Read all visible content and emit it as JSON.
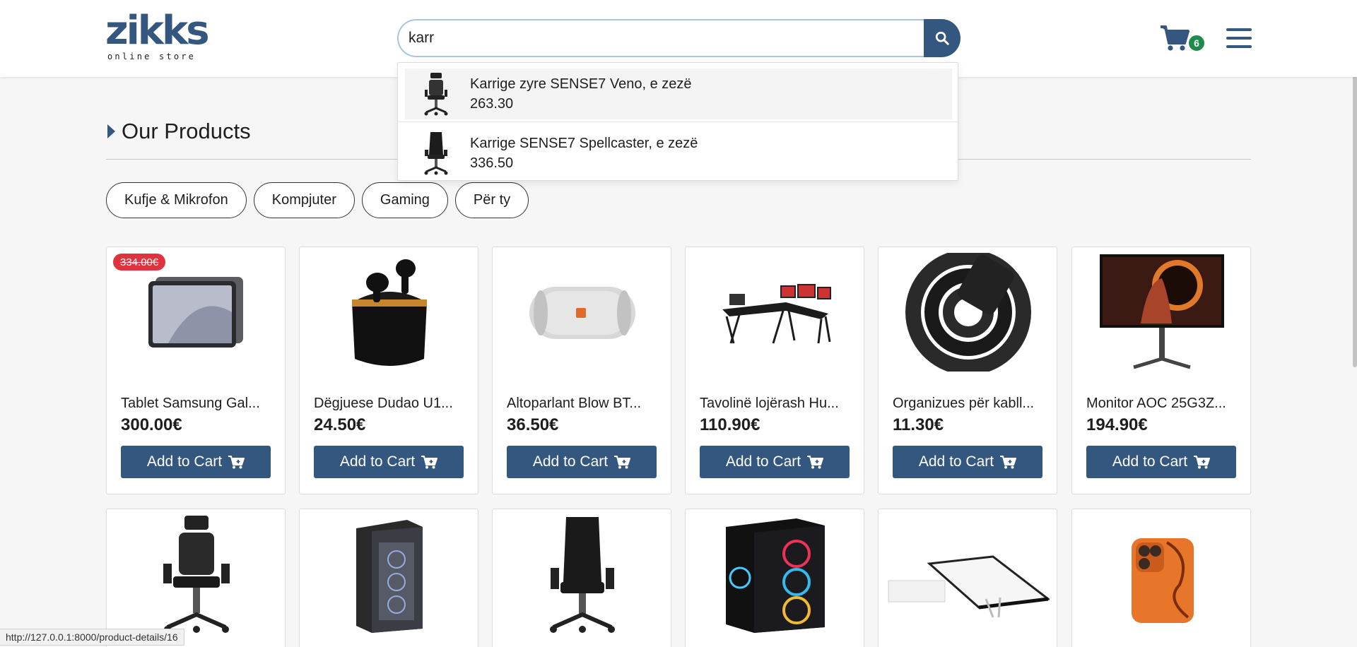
{
  "header": {
    "logo_text": "zikks",
    "logo_tagline": "online store",
    "search_value": "karr",
    "cart_count": "6"
  },
  "dropdown": {
    "items": [
      {
        "name": "Karrige zyre SENSE7 Veno, e zezë",
        "price": "263.30"
      },
      {
        "name": "Karrige SENSE7 Spellcaster, e zezë",
        "price": "336.50"
      }
    ]
  },
  "section": {
    "title": "Our Products"
  },
  "categories": [
    "Kufje & Mikrofon",
    "Kompjuter",
    "Gaming",
    "Për ty"
  ],
  "products": [
    {
      "name": "Tablet Samsung Gal...",
      "price": "300.00€",
      "old_price": "334.00€",
      "button": "Add to Cart"
    },
    {
      "name": "Dëgjuese Dudao U1...",
      "price": "24.50€",
      "button": "Add to Cart"
    },
    {
      "name": "Altoparlant Blow BT...",
      "price": "36.50€",
      "button": "Add to Cart"
    },
    {
      "name": "Tavolinë lojërash Hu...",
      "price": "110.90€",
      "button": "Add to Cart"
    },
    {
      "name": "Organizues për kabll...",
      "price": "11.30€",
      "button": "Add to Cart"
    },
    {
      "name": "Monitor AOC 25G3Z...",
      "price": "194.90€",
      "button": "Add to Cart"
    }
  ],
  "status_url": "http://127.0.0.1:8000/product-details/16",
  "colors": {
    "brand": "#33577e",
    "badge_green": "#1e8a4c",
    "sale_red": "#e03340"
  }
}
